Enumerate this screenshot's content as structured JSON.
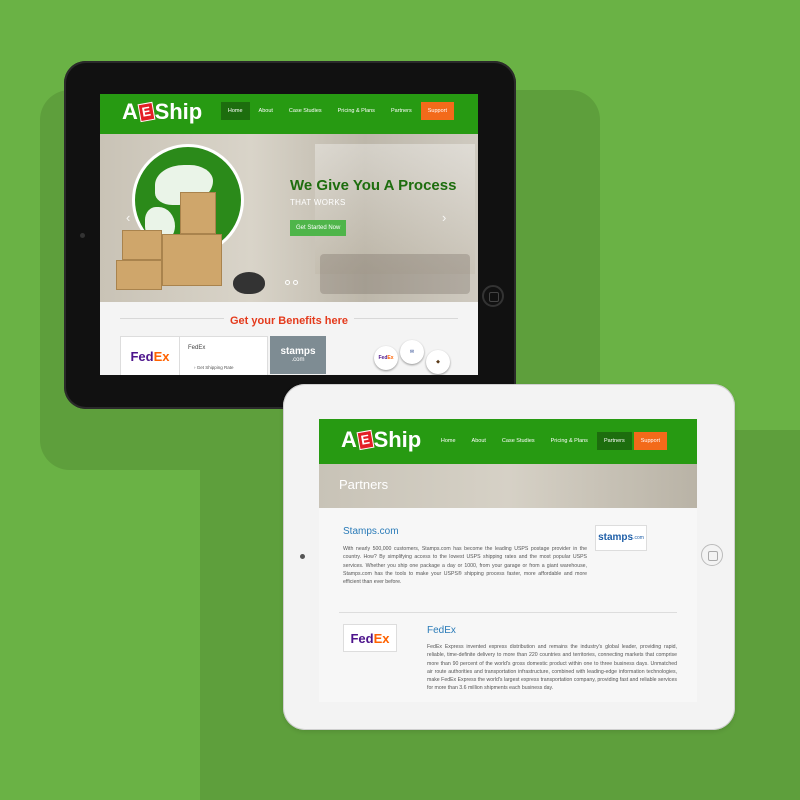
{
  "colors": {
    "background": "#6ab245",
    "header_green": "#279a12",
    "active_nav": "#1d6d0e",
    "support_orange": "#f36a1a",
    "benefits_red": "#e43a1c",
    "partner_title_blue": "#2a7bb8"
  },
  "tablet1": {
    "logo": {
      "a": "A",
      "e": "E",
      "ship": "Ship"
    },
    "nav": [
      {
        "label": "Home",
        "active": true
      },
      {
        "label": "About"
      },
      {
        "label": "Case Studies"
      },
      {
        "label": "Pricing & Plans"
      },
      {
        "label": "Partners"
      },
      {
        "label": "Support"
      }
    ],
    "hero": {
      "title": "We Give You A Process",
      "subtitle": "THAT WORKS",
      "button": "Get Started Now",
      "prev_arrow": "‹",
      "next_arrow": "›"
    },
    "benefits": {
      "title": "Get your Benefits here",
      "card_name": "FedEx",
      "card_link": "Get Shipping Rate",
      "fedex_logo": {
        "fed": "Fed",
        "ex": "Ex"
      },
      "stamps_logo": {
        "text": "stamps",
        "dotcom": ".com"
      }
    }
  },
  "tablet2": {
    "logo": {
      "a": "A",
      "e": "E",
      "ship": "Ship"
    },
    "nav": [
      {
        "label": "Home"
      },
      {
        "label": "About"
      },
      {
        "label": "Case Studies"
      },
      {
        "label": "Pricing & Plans"
      },
      {
        "label": "Partners",
        "active": true
      },
      {
        "label": "Support"
      }
    ],
    "banner_title": "Partners",
    "partners": [
      {
        "name": "Stamps.com",
        "text": "With nearly 500,000 customers, Stamps.com has become the leading USPS postage provider in the country. How? By simplifying access to the lowest USPS shipping rates and the most popular USPS services. Whether you ship one package a day or 1000, from your garage or from a giant warehouse, Stamps.com has the tools to make your USPS® shipping process faster, more affordable and more efficient than ever before.",
        "logo": {
          "text": "stamps",
          "dotcom": ".com"
        }
      },
      {
        "name": "FedEx",
        "text": "FedEx Express invented express distribution and remains the industry's global leader, providing rapid, reliable, time-definite delivery to more than 220 countries and territories, connecting markets that comprise more than 90 percent of the world's gross domestic product within one to three business days. Unmatched air route authorities and transportation infrastructure, combined with leading-edge information technologies, make FedEx Express the world's largest express transportation company, providing fast and reliable services for more than 3.6 million shipments each business day.",
        "logo": {
          "fed": "Fed",
          "ex": "Ex"
        }
      }
    ]
  }
}
